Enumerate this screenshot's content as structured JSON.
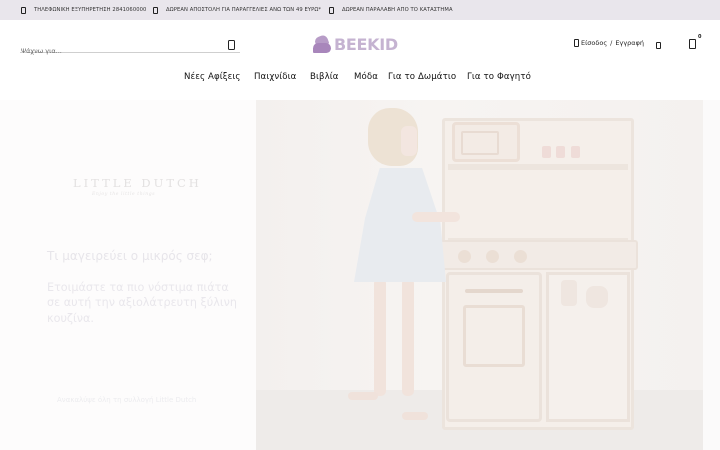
{
  "topbar": {
    "items": [
      {
        "icon": "phone-icon",
        "text": "ΤΗΛΕΦΩΝΙΚΗ ΕΞΥΠΗΡΕΤΗΣΗ 2841060000"
      },
      {
        "icon": "truck-icon",
        "text": "ΔΩΡΕΑΝ ΑΠΟΣΤΟΛΗ ΓΙΑ ΠΑΡΑΓΓΕΛΙΕΣ ΑΝΩ ΤΩΝ 49 ΕΥΡΩ*"
      },
      {
        "icon": "store-icon",
        "text": "ΔΩΡΕΑΝ ΠΑΡΑΛΑΒΗ ΑΠΟ ΤΟ ΚΑΤΑΣΤΗΜΑ"
      }
    ]
  },
  "header": {
    "search_placeholder": "Ψάχνω για...",
    "search_icon": "search-icon",
    "logo_text": "BEEKID",
    "logo_color": "#c5b3d1",
    "login_label": "Είσοδος",
    "separator": "/",
    "register_label": "Εγγραφή",
    "wishlist_icon": "heart-icon",
    "cart_icon": "cart-icon",
    "cart_count": "0"
  },
  "nav": {
    "items": [
      {
        "label": "Νέες Αφίξεις"
      },
      {
        "label": "Παιχνίδια"
      },
      {
        "label": "Βιβλία"
      },
      {
        "label": "Μόδα"
      },
      {
        "label": "Για το Δωμάτιο"
      },
      {
        "label": "Για το Φαγητό"
      }
    ]
  },
  "hero": {
    "brand_title": "LITTLE DUTCH",
    "brand_tagline": "Enjoy the little things",
    "heading": "Τι μαγειρεύει ο μικρός σεφ;",
    "text": "Ετοιμάστε τα πιο νόστιμα πιάτα σε αυτή την αξιολάτρευτη ξύλινη κουζίνα.",
    "link_label": "Ανακαλύψε όλη τη συλλογή Little Dutch"
  }
}
